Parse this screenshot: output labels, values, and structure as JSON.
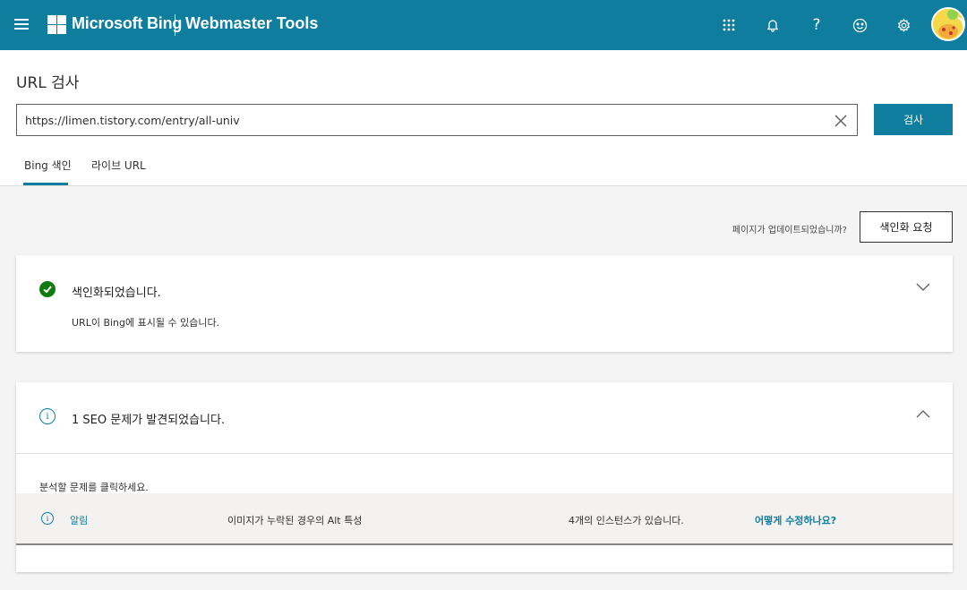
{
  "topbar": {
    "brand": "Microsoft Bing",
    "product": "Webmaster Tools",
    "icons": [
      "apps-grid-icon",
      "bell-icon",
      "help-icon",
      "smiley-icon",
      "gear-icon"
    ],
    "accent_color": "#0f7d9e"
  },
  "page": {
    "title": "URL 검사"
  },
  "search": {
    "value": "https://limen.tistory.com/entry/all-univ",
    "button_label": "검사"
  },
  "tabs": [
    {
      "label": "Bing 색인",
      "active": true
    },
    {
      "label": "라이브 URL",
      "active": false
    }
  ],
  "request": {
    "question": "페이지가 업데이트되었습니까?",
    "button_label": "색인화 요청"
  },
  "index_status": {
    "title": "색인화되었습니다.",
    "description": "URL이 Bing에 표시될 수 있습니다.",
    "status_color": "#107c10"
  },
  "seo": {
    "title": "1 SEO 문제가 발견되었습니다.",
    "hint": "분석할 문제를 클릭하세요.",
    "issues": [
      {
        "severity": "알림",
        "issue": "이미지가 누락된 경우의 Alt 특성",
        "instances": "4개의 인스턴스가 있습니다.",
        "fix_link": "어떻게 수정하나요?"
      }
    ]
  }
}
